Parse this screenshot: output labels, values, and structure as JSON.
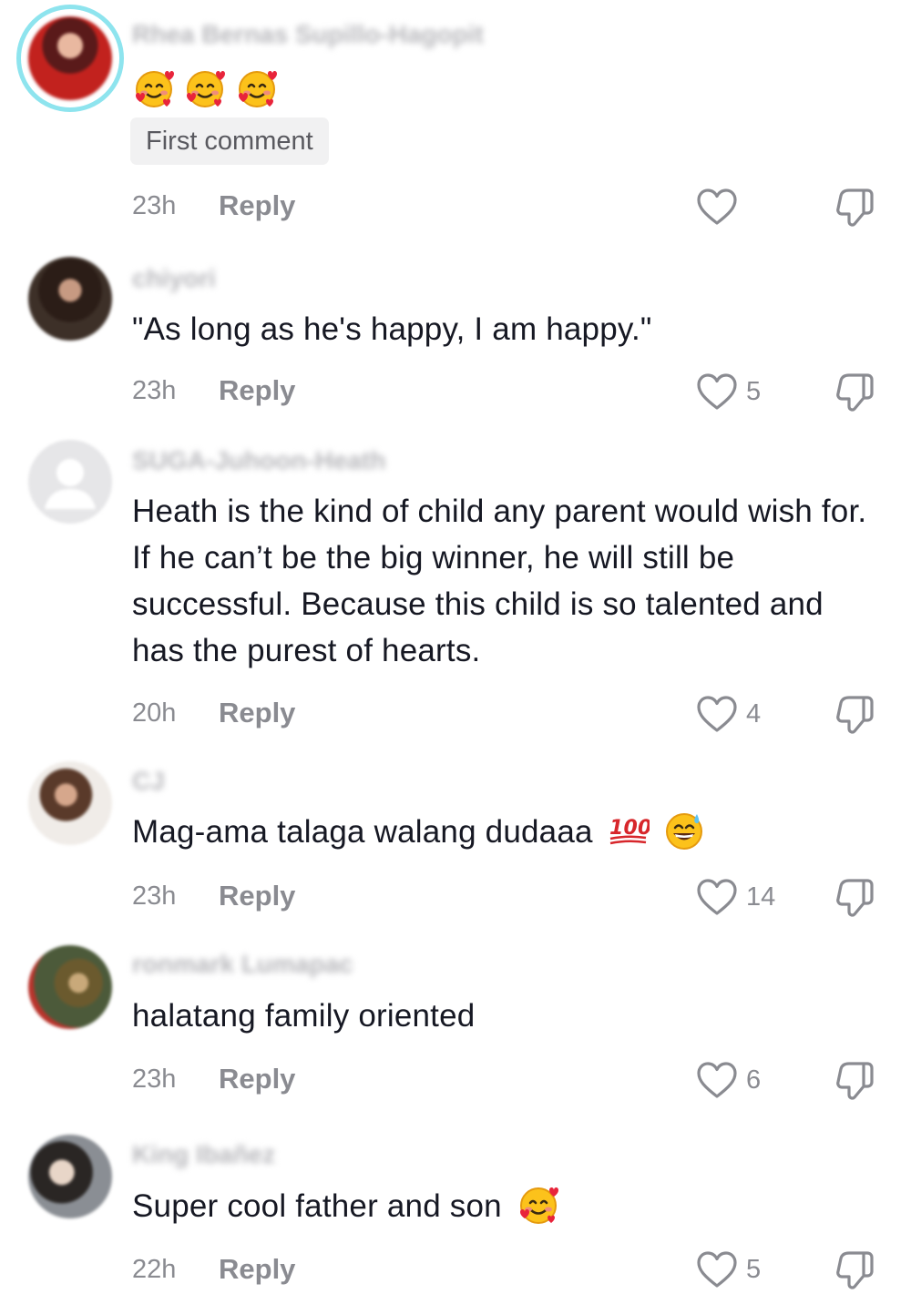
{
  "comments": [
    {
      "username": "Rhea Bernas Supillo-Hagopit",
      "text": "",
      "emojis": [
        "smiling-face-with-hearts",
        "smiling-face-with-hearts",
        "smiling-face-with-hearts"
      ],
      "badge": "First comment",
      "time": "23h",
      "reply_label": "Reply",
      "likes": ""
    },
    {
      "username": "chiyori",
      "text": "\"As long as he's happy, I am happy.\"",
      "time": "23h",
      "reply_label": "Reply",
      "likes": "5"
    },
    {
      "username": "SUGA-Juhoon-Heath",
      "text": "Heath is the kind of child any parent would wish for. If he can’t be the big winner, he will still be successful. Because this child is so talented and has the purest of hearts.",
      "time": "20h",
      "reply_label": "Reply",
      "likes": "4"
    },
    {
      "username": "CJ",
      "text": "Mag-ama talaga walang dudaaa",
      "emojis": [
        "hundred-points",
        "grinning-sweat"
      ],
      "time": "23h",
      "reply_label": "Reply",
      "likes": "14"
    },
    {
      "username": "ronmark Lumapac",
      "text": "halatang family oriented",
      "time": "23h",
      "reply_label": "Reply",
      "likes": "6"
    },
    {
      "username": "King Ibañez",
      "text": "Super cool father and son",
      "emojis": [
        "smiling-face-with-hearts"
      ],
      "time": "22h",
      "reply_label": "Reply",
      "likes": "5"
    }
  ],
  "colors": {
    "text": "#161823",
    "secondary": "#8a8b91",
    "badge_bg": "#f1f1f2",
    "avatar_ring": "#8ee4ee"
  }
}
